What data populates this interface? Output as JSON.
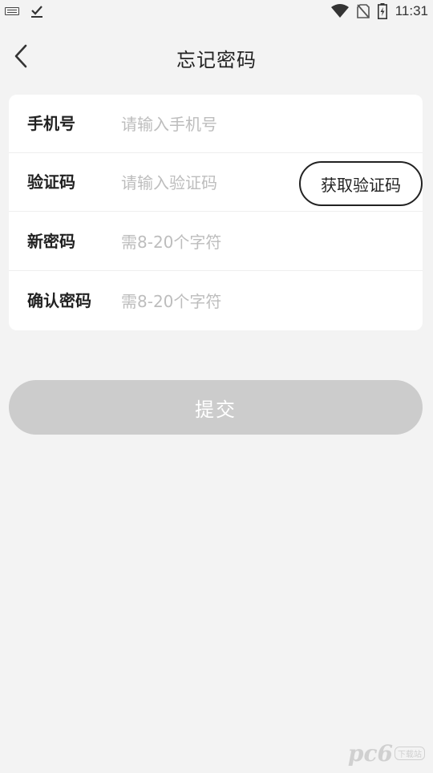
{
  "status_bar": {
    "time": "11:31",
    "icons": [
      "keyboard-icon",
      "download-done-icon",
      "wifi-icon",
      "no-sim-icon",
      "battery-charging-icon"
    ]
  },
  "header": {
    "title": "忘记密码",
    "back_icon": "chevron-left-icon"
  },
  "form": {
    "phone": {
      "label": "手机号",
      "placeholder": "请输入手机号",
      "value": ""
    },
    "code": {
      "label": "验证码",
      "placeholder": "请输入验证码",
      "value": "",
      "button_label": "获取验证码"
    },
    "new_password": {
      "label": "新密码",
      "placeholder": "需8-20个字符",
      "value": ""
    },
    "confirm_password": {
      "label": "确认密码",
      "placeholder": "需8-20个字符",
      "value": ""
    }
  },
  "submit": {
    "label": "提交"
  },
  "watermark": {
    "text": "pc6",
    "sub": "下载站"
  },
  "colors": {
    "background": "#f3f3f3",
    "card": "#ffffff",
    "submit_disabled": "#cccccc",
    "placeholder": "#bdbdbd",
    "text": "#222222"
  }
}
